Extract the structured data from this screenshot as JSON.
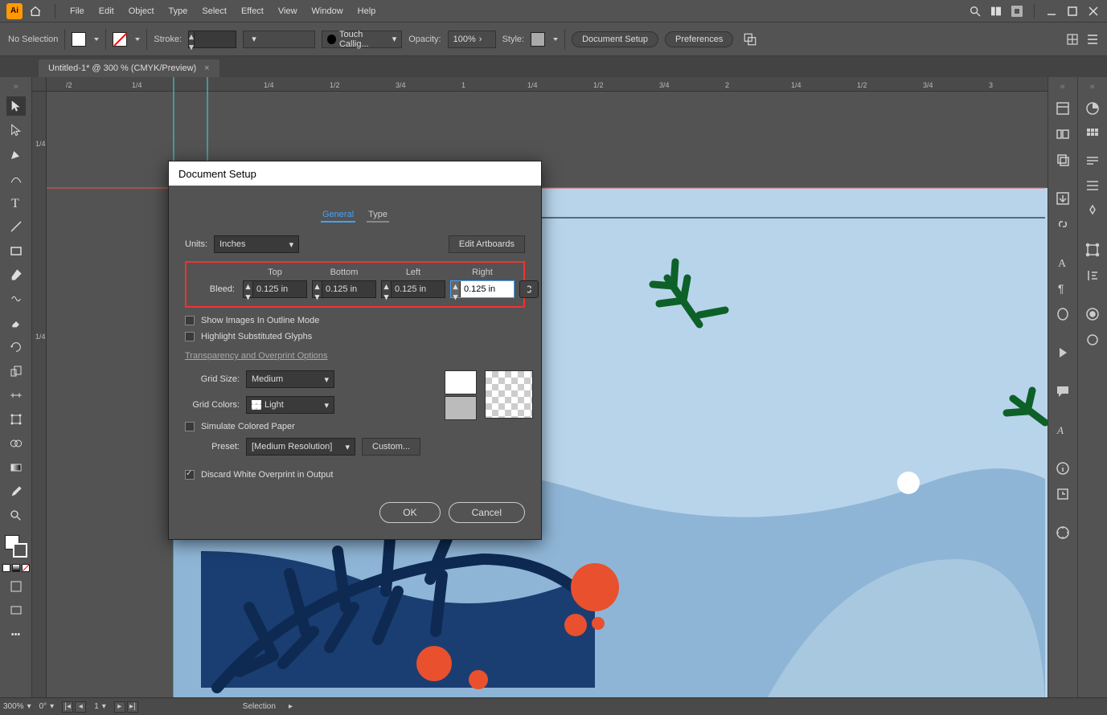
{
  "menu": {
    "file": "File",
    "edit": "Edit",
    "object": "Object",
    "type_m": "Type",
    "select": "Select",
    "effect": "Effect",
    "view": "View",
    "window": "Window",
    "help": "Help"
  },
  "controlbar": {
    "selection": "No Selection",
    "stroke": "Stroke:",
    "stroke_val": "",
    "brush": "Touch Callig...",
    "opacity": "Opacity:",
    "opacity_val": "100%",
    "style": "Style:",
    "doc_setup": "Document Setup",
    "prefs": "Preferences"
  },
  "tab": {
    "title": "Untitled-1* @ 300 % (CMYK/Preview)"
  },
  "ruler_h": [
    "/2",
    "1/4",
    "",
    "1/4",
    "1/2",
    "3/4",
    "1",
    "1/4",
    "1/2",
    "3/4",
    "2",
    "1/4",
    "1/2",
    "3/4",
    "3"
  ],
  "ruler_v": [
    "",
    "1/4",
    "",
    "1/4"
  ],
  "statusbar": {
    "zoom": "300%",
    "angle": "0°",
    "page": "1",
    "mode": "Selection"
  },
  "dialog": {
    "title": "Document Setup",
    "tabs": {
      "general": "General",
      "type": "Type"
    },
    "units_label": "Units:",
    "units_val": "Inches",
    "edit_artboards": "Edit Artboards",
    "bleed": {
      "label": "Bleed:",
      "top_h": "Top",
      "bottom_h": "Bottom",
      "left_h": "Left",
      "right_h": "Right",
      "top": "0.125 in",
      "bottom": "0.125 in",
      "left": "0.125 in",
      "right": "0.125 in"
    },
    "show_outline": "Show Images In Outline Mode",
    "highlight_glyphs": "Highlight Substituted Glyphs",
    "transp_section": "Transparency and Overprint Options",
    "grid_size_l": "Grid Size:",
    "grid_size_v": "Medium",
    "grid_colors_l": "Grid Colors:",
    "grid_colors_v": "Light",
    "sim_paper": "Simulate Colored Paper",
    "preset_l": "Preset:",
    "preset_v": "[Medium Resolution]",
    "custom": "Custom...",
    "discard": "Discard White Overprint in Output",
    "ok": "OK",
    "cancel": "Cancel"
  }
}
